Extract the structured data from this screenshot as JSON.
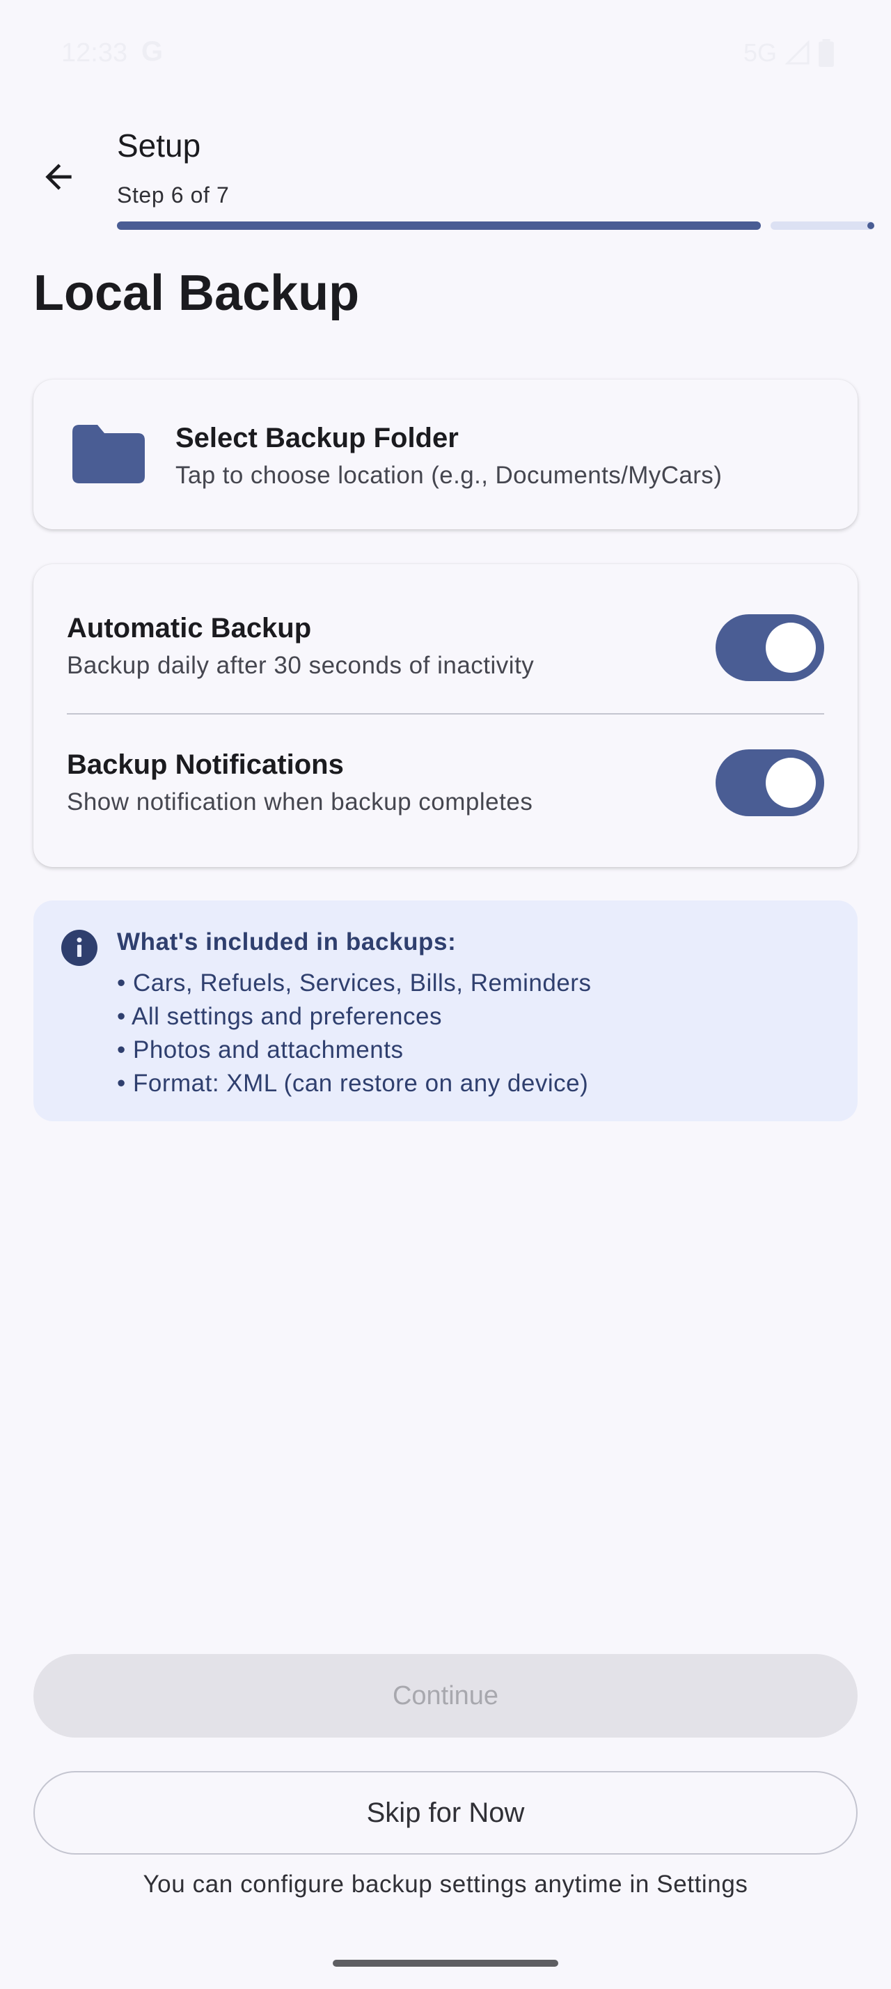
{
  "status_bar": {
    "time": "12:33",
    "carrier_logo": "G",
    "network": "5G",
    "signal_icon": "signal-icon",
    "battery_icon": "battery-icon"
  },
  "header": {
    "back_icon": "arrow-back-icon",
    "title": "Setup",
    "subtitle": "Step 6 of 7",
    "progress": {
      "current_step": 6,
      "total_steps": 7,
      "fraction": 0.857
    }
  },
  "page_title": "Local Backup",
  "folder_card": {
    "icon": "folder-icon",
    "title": "Select Backup Folder",
    "subtitle": "Tap to choose location (e.g., Documents/MyCars)"
  },
  "settings": [
    {
      "title": "Automatic Backup",
      "subtitle": "Backup daily after 30 seconds of inactivity",
      "enabled": true
    },
    {
      "title": "Backup Notifications",
      "subtitle": "Show notification when backup completes",
      "enabled": true
    }
  ],
  "info": {
    "icon": "info-icon",
    "title": "What's included in backups:",
    "items": [
      "• Cars, Refuels, Services, Bills, Reminders",
      "• All settings and preferences",
      "• Photos and attachments",
      "• Format: XML (can restore on any device)"
    ]
  },
  "buttons": {
    "continue_label": "Continue",
    "continue_enabled": false,
    "skip_label": "Skip for Now"
  },
  "footer_note": "You can configure backup settings anytime in Settings",
  "colors": {
    "primary": "#4A5D94",
    "background": "#F8F7FC",
    "info_background": "#E9EDFC",
    "info_text": "#2F3F6E",
    "disabled_button": "#E3E2E8"
  }
}
